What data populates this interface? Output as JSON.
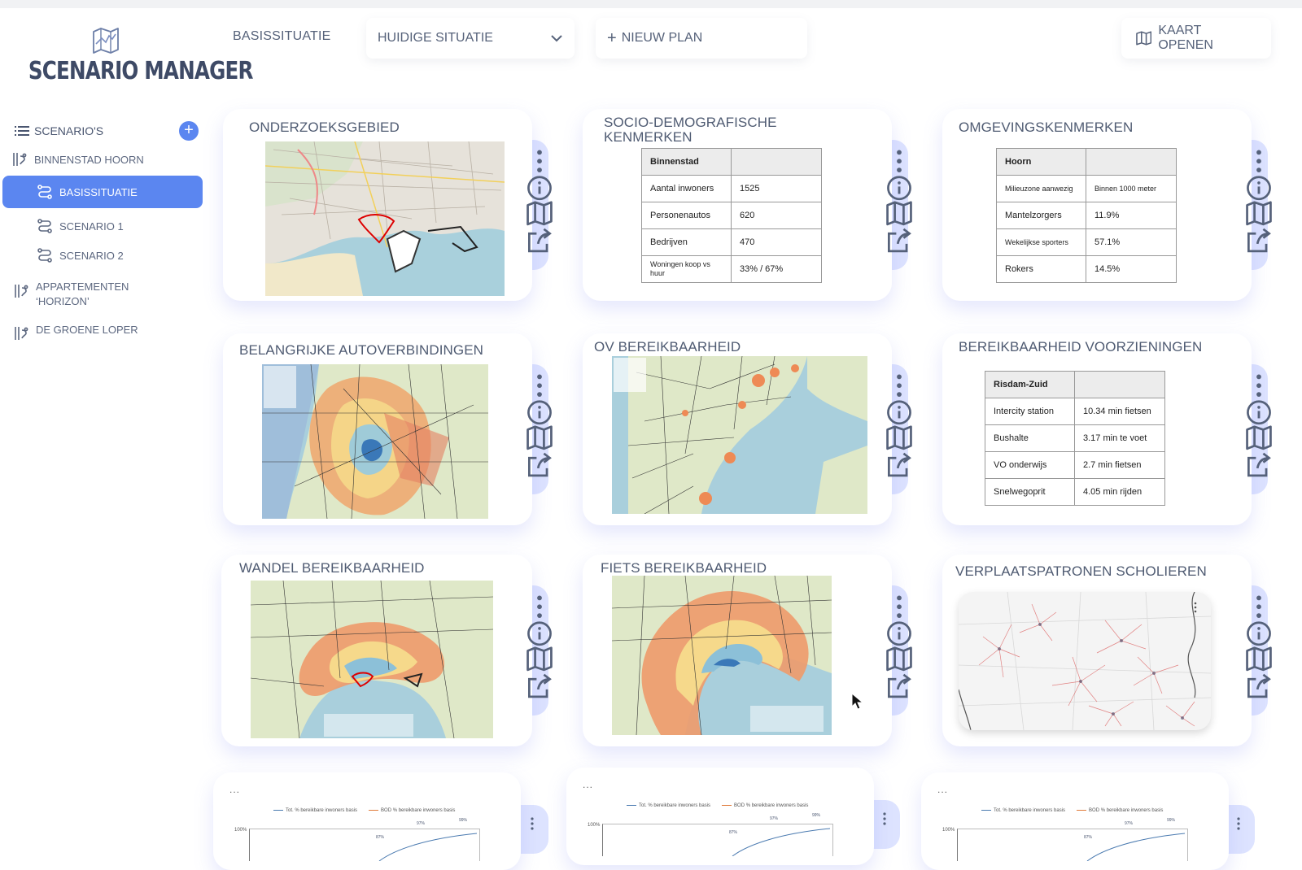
{
  "app": {
    "name": "SCENARIO MANAGER"
  },
  "sidebar": {
    "section_label": "SCENARIO'S",
    "add_label": "+",
    "items": [
      {
        "label": "BINNENSTAD HOORN",
        "icon": "project-icon"
      },
      {
        "label": "BASISSITUATIE",
        "icon": "route-icon",
        "active": true
      },
      {
        "label": "SCENARIO 1",
        "icon": "route-icon"
      },
      {
        "label": "SCENARIO 2",
        "icon": "route-icon"
      },
      {
        "label": "APPARTEMENTEN ‘HORIZON’",
        "icon": "project-icon"
      },
      {
        "label": "DE GROENE LOPER",
        "icon": "project-icon"
      }
    ]
  },
  "topbar": {
    "basis_label": "BASISSITUATIE",
    "select_value": "HUIDIGE SITUATIE",
    "new_plan_label": "NIEUW PLAN",
    "new_plan_icon": "+",
    "open_map_label": "KAART OPENEN"
  },
  "cards": {
    "onderzoek": {
      "title": "ONDERZOEKSGEBIED"
    },
    "socio": {
      "title": "SOCIO-DEMOGRAFISCHE KENMERKEN",
      "rows": [
        [
          "Binnenstad",
          ""
        ],
        [
          "Aantal inwoners",
          "1525"
        ],
        [
          "Personenautos",
          "620"
        ],
        [
          "Bedrijven",
          "470"
        ],
        [
          "Woningen koop vs huur",
          "33% / 67%"
        ]
      ]
    },
    "omgeving": {
      "title": "OMGEVINGSKENMERKEN",
      "rows": [
        [
          "Hoorn",
          ""
        ],
        [
          "Milieuzone aanwezig",
          "Binnen 1000 meter"
        ],
        [
          "Mantelzorgers",
          "11.9%"
        ],
        [
          "Wekelijkse sporters",
          "57.1%"
        ],
        [
          "Rokers",
          "14.5%"
        ]
      ]
    },
    "auto": {
      "title": "BELANGRIJKE AUTOVERBINDINGEN"
    },
    "ov": {
      "title": "OV BEREIKBAARHEID"
    },
    "voorz": {
      "title": "BEREIKBAARHEID VOORZIENINGEN",
      "rows": [
        [
          "Risdam-Zuid",
          ""
        ],
        [
          "Intercity station",
          "10.34 min fietsen"
        ],
        [
          "Bushalte",
          "3.17 min te voet"
        ],
        [
          "VO onderwijs",
          "2.7 min fietsen"
        ],
        [
          "Snelwegoprit",
          "4.05 min rijden"
        ]
      ]
    },
    "wandel": {
      "title": "WANDEL BEREIKBAARHEID"
    },
    "fiets": {
      "title": "FIETS BEREIKBAARHEID"
    },
    "scholieren": {
      "title": "VERPLAATSPATRONEN SCHOLIEREN"
    }
  },
  "mini_charts": {
    "more_label": "...",
    "legend_a": "Tot. % bereikbare inwoners basis",
    "legend_b": "BOD % bereikbare inwoners basis",
    "y_tick": "100%",
    "labels": [
      "87%",
      "97%",
      "99%"
    ]
  },
  "colors": {
    "accent": "#5b86f0",
    "rail": "#dde3ff",
    "text": "#4f5b72"
  }
}
